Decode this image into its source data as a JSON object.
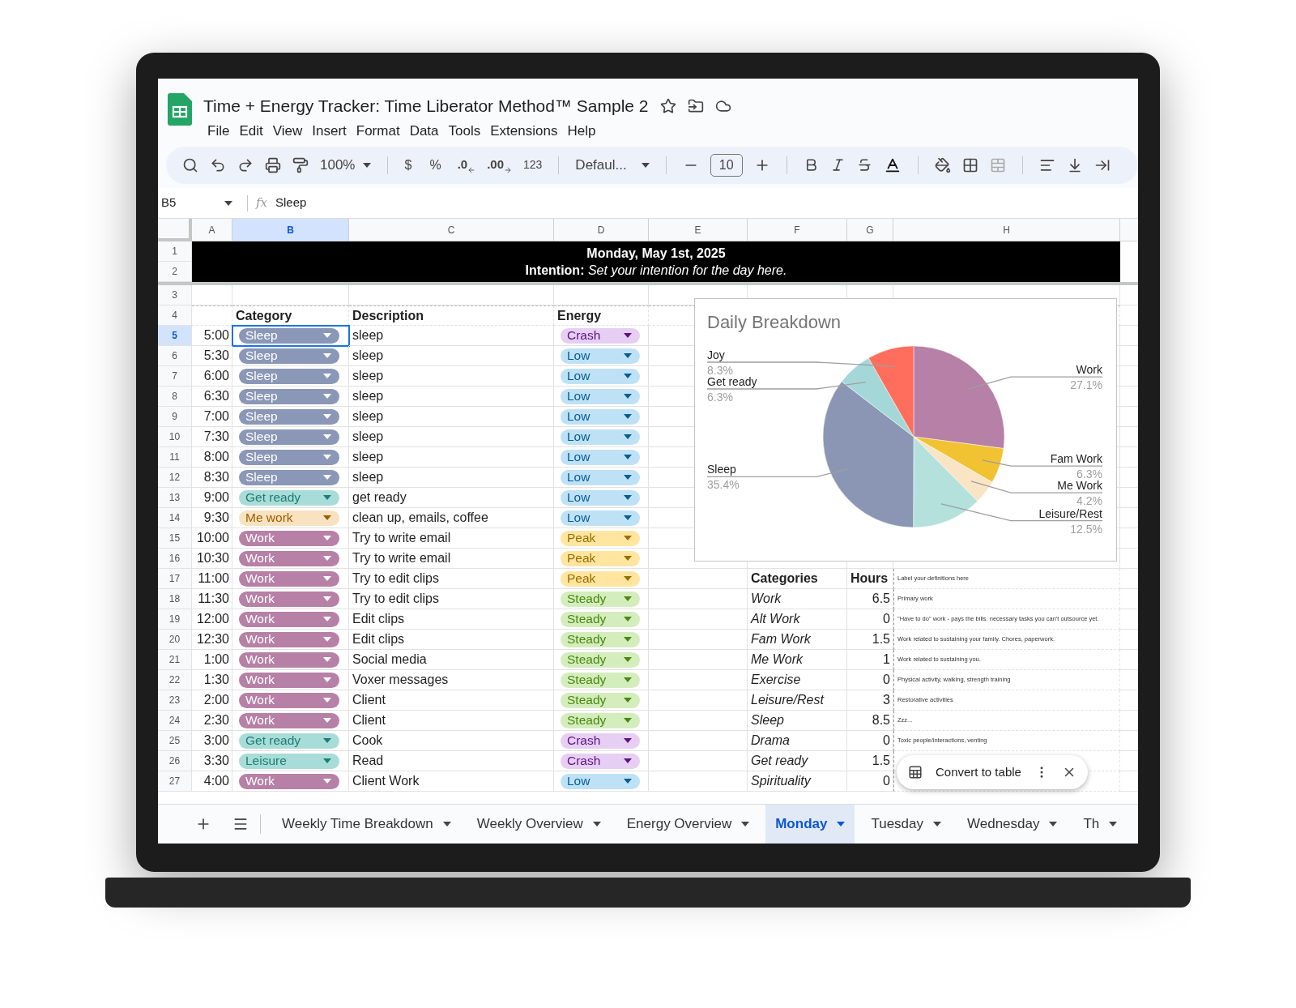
{
  "document": {
    "title": "Time + Energy Tracker: Time Liberator Method™ Sample 2"
  },
  "menu": [
    "File",
    "Edit",
    "View",
    "Insert",
    "Format",
    "Data",
    "Tools",
    "Extensions",
    "Help"
  ],
  "toolbar": {
    "zoom": "100%",
    "currency": "$",
    "percent": "%",
    "decrease_decimal": ".0",
    "increase_decimal": ".00",
    "number_format": "123",
    "font": "Defaul...",
    "font_size": "10"
  },
  "formula_bar": {
    "cell": "B5",
    "function_label": "fx",
    "formula": "Sleep"
  },
  "columns": [
    {
      "label": "A",
      "selected": false
    },
    {
      "label": "B",
      "selected": true
    },
    {
      "label": "C",
      "selected": false
    },
    {
      "label": "D",
      "selected": false
    },
    {
      "label": "E",
      "selected": false
    },
    {
      "label": "F",
      "selected": false
    },
    {
      "label": "G",
      "selected": false
    },
    {
      "label": "H",
      "selected": false
    }
  ],
  "row_numbers": [
    {
      "label": "1",
      "selected": false
    },
    {
      "label": "2",
      "selected": false
    },
    {
      "label": "3",
      "selected": false
    },
    {
      "label": "4",
      "selected": false
    },
    {
      "label": "5",
      "selected": true
    },
    {
      "label": "6",
      "selected": false
    },
    {
      "label": "7",
      "selected": false
    },
    {
      "label": "8",
      "selected": false
    },
    {
      "label": "9",
      "selected": false
    },
    {
      "label": "10",
      "selected": false
    },
    {
      "label": "11",
      "selected": false
    },
    {
      "label": "12",
      "selected": false
    },
    {
      "label": "13",
      "selected": false
    },
    {
      "label": "14",
      "selected": false
    },
    {
      "label": "15",
      "selected": false
    },
    {
      "label": "16",
      "selected": false
    },
    {
      "label": "17",
      "selected": false
    },
    {
      "label": "18",
      "selected": false
    },
    {
      "label": "19",
      "selected": false
    },
    {
      "label": "20",
      "selected": false
    },
    {
      "label": "21",
      "selected": false
    },
    {
      "label": "22",
      "selected": false
    },
    {
      "label": "23",
      "selected": false
    },
    {
      "label": "24",
      "selected": false
    },
    {
      "label": "25",
      "selected": false
    },
    {
      "label": "26",
      "selected": false
    },
    {
      "label": "27",
      "selected": false
    }
  ],
  "banner": {
    "date": "Monday, May 1st, 2025",
    "intention": "**Intention:** *Set your intention for the day here.*"
  },
  "headers": {
    "category": "Category",
    "description": "Description",
    "energy": "Energy"
  },
  "schedule": [
    {
      "time": "5:00",
      "selected": true,
      "category": {
        "label": "Sleep",
        "color": "#8b97b6"
      },
      "description": "sleep",
      "energy": {
        "label": "Crash",
        "color": "#e6cff2"
      }
    },
    {
      "time": "5:30",
      "selected": false,
      "category": {
        "label": "Sleep",
        "color": "#8b97b6"
      },
      "description": "sleep",
      "energy": {
        "label": "Low",
        "color": "#bfe1f6"
      }
    },
    {
      "time": "6:00",
      "selected": false,
      "category": {
        "label": "Sleep",
        "color": "#8b97b6"
      },
      "description": "sleep",
      "energy": {
        "label": "Low",
        "color": "#bfe1f6"
      }
    },
    {
      "time": "6:30",
      "selected": false,
      "category": {
        "label": "Sleep",
        "color": "#8b97b6"
      },
      "description": "sleep",
      "energy": {
        "label": "Low",
        "color": "#bfe1f6"
      }
    },
    {
      "time": "7:00",
      "selected": false,
      "category": {
        "label": "Sleep",
        "color": "#8b97b6"
      },
      "description": "sleep",
      "energy": {
        "label": "Low",
        "color": "#bfe1f6"
      }
    },
    {
      "time": "7:30",
      "selected": false,
      "category": {
        "label": "Sleep",
        "color": "#8b97b6"
      },
      "description": "sleep",
      "energy": {
        "label": "Low",
        "color": "#bfe1f6"
      }
    },
    {
      "time": "8:00",
      "selected": false,
      "category": {
        "label": "Sleep",
        "color": "#8b97b6"
      },
      "description": "sleep",
      "energy": {
        "label": "Low",
        "color": "#bfe1f6"
      }
    },
    {
      "time": "8:30",
      "selected": false,
      "category": {
        "label": "Sleep",
        "color": "#8b97b6"
      },
      "description": "sleep",
      "energy": {
        "label": "Low",
        "color": "#bfe1f6"
      }
    },
    {
      "time": "9:00",
      "selected": false,
      "category": {
        "label": "Get ready",
        "color": "#a8dcd8"
      },
      "description": "get ready",
      "energy": {
        "label": "Low",
        "color": "#bfe1f6"
      }
    },
    {
      "time": "9:30",
      "selected": false,
      "category": {
        "label": "Me work",
        "color": "#f8e2bf"
      },
      "description": "clean up, emails, coffee",
      "energy": {
        "label": "Low",
        "color": "#bfe1f6"
      }
    },
    {
      "time": "10:00",
      "selected": false,
      "category": {
        "label": "Work",
        "color": "#b780a6"
      },
      "description": "Try to write email",
      "energy": {
        "label": "Peak",
        "color": "#ffe5a0"
      }
    },
    {
      "time": "10:30",
      "selected": false,
      "category": {
        "label": "Work",
        "color": "#b780a6"
      },
      "description": "Try to write email",
      "energy": {
        "label": "Peak",
        "color": "#ffe5a0"
      }
    },
    {
      "time": "11:00",
      "selected": false,
      "category": {
        "label": "Work",
        "color": "#b780a6"
      },
      "description": "Try to edit clips",
      "energy": {
        "label": "Peak",
        "color": "#ffe5a0"
      }
    },
    {
      "time": "11:30",
      "selected": false,
      "category": {
        "label": "Work",
        "color": "#b780a6"
      },
      "description": "Try to edit clips",
      "energy": {
        "label": "Steady",
        "color": "#d4edbc"
      }
    },
    {
      "time": "12:00",
      "selected": false,
      "category": {
        "label": "Work",
        "color": "#b780a6"
      },
      "description": "Edit clips",
      "energy": {
        "label": "Steady",
        "color": "#d4edbc"
      }
    },
    {
      "time": "12:30",
      "selected": false,
      "category": {
        "label": "Work",
        "color": "#b780a6"
      },
      "description": "Edit clips",
      "energy": {
        "label": "Steady",
        "color": "#d4edbc"
      }
    },
    {
      "time": "1:00",
      "selected": false,
      "category": {
        "label": "Work",
        "color": "#b780a6"
      },
      "description": "Social media",
      "energy": {
        "label": "Steady",
        "color": "#d4edbc"
      }
    },
    {
      "time": "1:30",
      "selected": false,
      "category": {
        "label": "Work",
        "color": "#b780a6"
      },
      "description": "Voxer messages",
      "energy": {
        "label": "Steady",
        "color": "#d4edbc"
      }
    },
    {
      "time": "2:00",
      "selected": false,
      "category": {
        "label": "Work",
        "color": "#b780a6"
      },
      "description": "Client",
      "energy": {
        "label": "Steady",
        "color": "#d4edbc"
      }
    },
    {
      "time": "2:30",
      "selected": false,
      "category": {
        "label": "Work",
        "color": "#b780a6"
      },
      "description": "Client",
      "energy": {
        "label": "Steady",
        "color": "#d4edbc"
      }
    },
    {
      "time": "3:00",
      "selected": false,
      "category": {
        "label": "Get ready",
        "color": "#a8dcd8"
      },
      "description": "Cook",
      "energy": {
        "label": "Crash",
        "color": "#e6cff2"
      }
    },
    {
      "time": "3:30",
      "selected": false,
      "category": {
        "label": "Leisure",
        "color": "#a8dcd8"
      },
      "description": "Read",
      "energy": {
        "label": "Crash",
        "color": "#e6cff2"
      }
    },
    {
      "time": "4:00",
      "selected": false,
      "category": {
        "label": "Work",
        "color": "#b780a6"
      },
      "description": "Client Work",
      "energy": {
        "label": "Low",
        "color": "#bfe1f6"
      }
    }
  ],
  "summary": {
    "headers": [
      "Categories",
      "Hours"
    ],
    "note": "Label your definitions here",
    "rows": [
      {
        "category": "Work",
        "hours": "6.5",
        "definition": "Primary work"
      },
      {
        "category": "Alt Work",
        "hours": "0",
        "definition": "\"Have to do\" work - pays the bills. necessary tasks you can't outsource yet."
      },
      {
        "category": "Fam Work",
        "hours": "1.5",
        "definition": "Work related to sustaining your family. Chores, paperwork."
      },
      {
        "category": "Me Work",
        "hours": "1",
        "definition": "Work related to sustaining you."
      },
      {
        "category": "Exercise",
        "hours": "0",
        "definition": "Physical activity, walking, strength training"
      },
      {
        "category": "Leisure/Rest",
        "hours": "3",
        "definition": "Restorative activities"
      },
      {
        "category": "Sleep",
        "hours": "8.5",
        "definition": "Zzz..."
      },
      {
        "category": "Drama",
        "hours": "0",
        "definition": "Toxic people/interactions, venting"
      },
      {
        "category": "Get ready",
        "hours": "1.5"
      },
      {
        "category": "Spirituality",
        "hours": "0"
      }
    ]
  },
  "chart": {
    "chart_data": {
      "type": "pie",
      "title": "Daily Breakdown",
      "categories": [
        "Work",
        "Fam Work",
        "Me Work",
        "Leisure/Rest",
        "Sleep",
        "Get ready",
        "Joy"
      ],
      "series": [
        {
          "values": [
            27.1,
            6.3,
            4.2,
            12.5,
            35.4,
            6.3,
            8.3
          ],
          "colors": [
            "#b780a6",
            "#f1c232",
            "#f9e4c4",
            "#b4e1dc",
            "#8a96b4",
            "#a4d8d8",
            "#ff6d5d"
          ]
        }
      ],
      "value_labels": [
        "27.1%",
        "6.3%",
        "4.2%",
        "12.5%",
        "35.4%",
        "6.3%",
        "8.3%"
      ]
    }
  },
  "popup": {
    "label": "Convert to table"
  },
  "sheet_tabs": [
    {
      "label": "Weekly Time Breakdown",
      "selected": false
    },
    {
      "label": "Weekly Overview",
      "selected": false
    },
    {
      "label": "Energy Overview",
      "selected": false
    },
    {
      "label": "Monday",
      "selected": true
    },
    {
      "label": "Tuesday",
      "selected": false
    },
    {
      "label": "Wednesday",
      "selected": false
    },
    {
      "label": "Th",
      "selected": false
    }
  ]
}
